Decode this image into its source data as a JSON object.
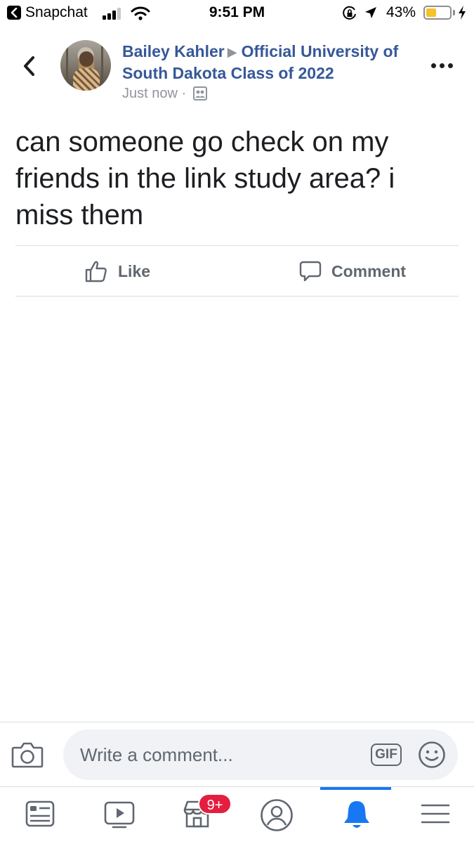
{
  "status_bar": {
    "back_app": "Snapchat",
    "time": "9:51 PM",
    "battery_percent": "43%",
    "battery_level": 0.43,
    "signal_bars_filled": 3
  },
  "post": {
    "author": "Bailey Kahler",
    "group": "Official University of South Dakota Class of 2022",
    "timestamp": "Just now",
    "separator": "·",
    "text": "can someone go check on my friends in the link study area? i miss them"
  },
  "actions": {
    "like_label": "Like",
    "comment_label": "Comment"
  },
  "comment_bar": {
    "placeholder": "Write a comment...",
    "gif_label": "GIF"
  },
  "tab_bar": {
    "marketplace_badge": "9+",
    "active_tab": "notifications"
  },
  "colors": {
    "accent": "#1877f2",
    "author_link": "#365899",
    "badge": "#e41e3f",
    "muted": "#606770",
    "battery": "#f5c22b"
  },
  "icons": [
    "back-icon",
    "signal-icon",
    "wifi-icon",
    "orientation-lock-icon",
    "location-icon",
    "battery-icon",
    "charging-icon",
    "chevron-left-icon",
    "more-icon",
    "group-icon",
    "like-icon",
    "comment-icon",
    "camera-icon",
    "emoji-icon",
    "news-feed-icon",
    "watch-icon",
    "marketplace-icon",
    "profile-icon",
    "bell-icon",
    "menu-icon"
  ]
}
